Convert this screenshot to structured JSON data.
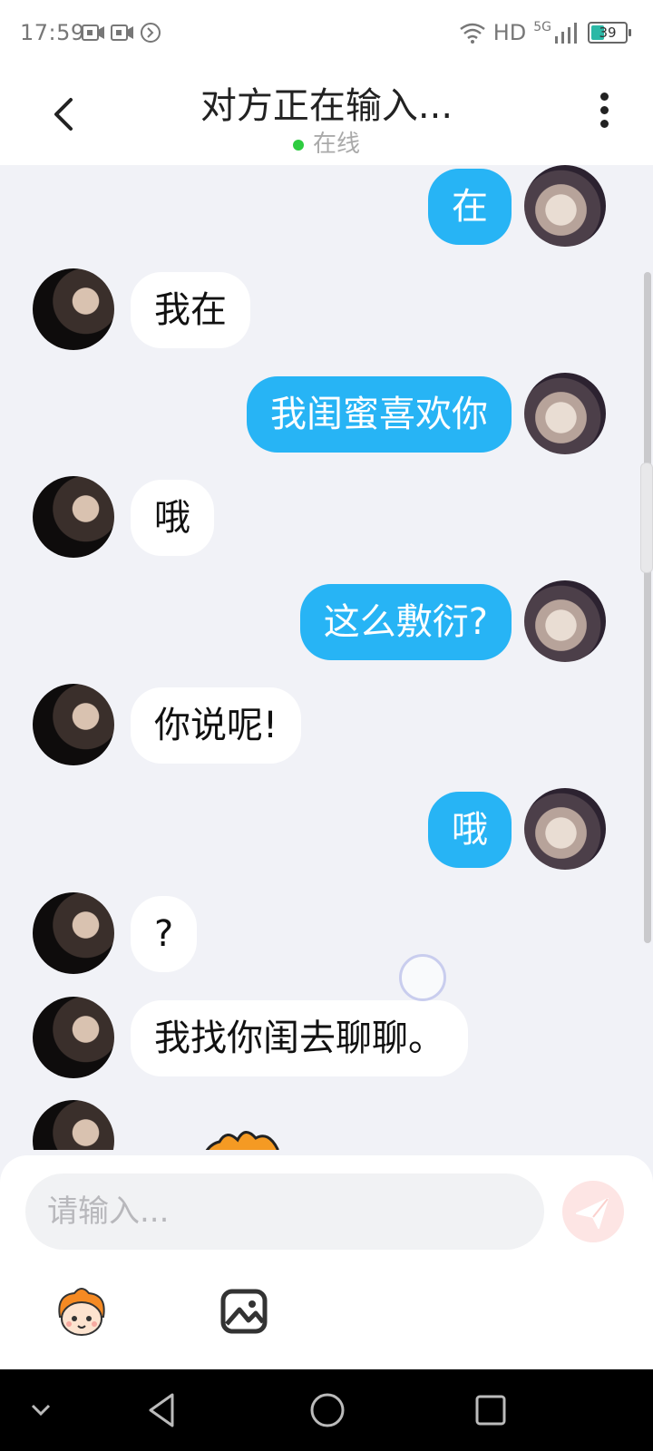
{
  "status_bar": {
    "time": "17:59",
    "network": "HD",
    "signal": "5G",
    "battery": "39"
  },
  "header": {
    "title": "对方正在输入...",
    "status": "在线",
    "online_color": "#2ecc40"
  },
  "messages": [
    {
      "side": "right",
      "text": "在"
    },
    {
      "side": "left",
      "text": "我在"
    },
    {
      "side": "right",
      "text": "我闺蜜喜欢你"
    },
    {
      "side": "left",
      "text": "哦"
    },
    {
      "side": "right",
      "text": "这么敷衍?"
    },
    {
      "side": "left",
      "text": "你说呢!"
    },
    {
      "side": "right",
      "text": "哦"
    },
    {
      "side": "left",
      "text": "?"
    },
    {
      "side": "left",
      "text": "我找你闺去聊聊。"
    }
  ],
  "composer": {
    "placeholder": "请输入..."
  },
  "colors": {
    "outgoing_bubble": "#27b4f5",
    "incoming_bubble": "#ffffff",
    "background": "#f1f2f7"
  },
  "icons": {
    "back": "chevron-left-icon",
    "more": "more-vertical-icon",
    "send": "paper-plane-icon",
    "emoji": "emoji-mascot-icon",
    "image": "image-icon"
  }
}
